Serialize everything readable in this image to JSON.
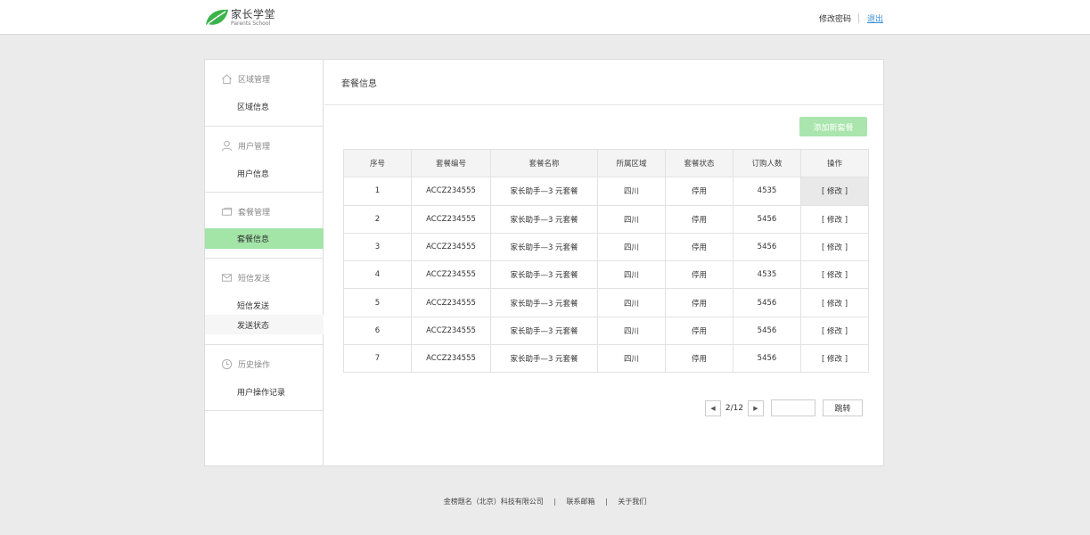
{
  "header": {
    "logo_cn": "家长学堂",
    "logo_en": "Parents School",
    "change_password": "修改密码",
    "logout": "退出"
  },
  "sidebar": {
    "groups": [
      {
        "title": "区域管理",
        "icon": "home-icon",
        "items": [
          "区域信息"
        ]
      },
      {
        "title": "用户管理",
        "icon": "user-icon",
        "items": [
          "用户信息"
        ]
      },
      {
        "title": "套餐管理",
        "icon": "card-icon",
        "items": [
          "套餐信息"
        ]
      },
      {
        "title": "短信发送",
        "icon": "mail-icon",
        "items": [
          "短信发送",
          "发送状态"
        ]
      },
      {
        "title": "历史操作",
        "icon": "clock-icon",
        "items": [
          "用户操作记录"
        ]
      }
    ],
    "active_item": "套餐信息"
  },
  "content": {
    "title": "套餐信息",
    "add_button": "添加新套餐",
    "columns": [
      "序号",
      "套餐编号",
      "套餐名称",
      "所属区域",
      "套餐状态",
      "订购人数",
      "操作"
    ],
    "rows": [
      [
        "1",
        "ACCZ234555",
        "家长助手—3 元套餐",
        "四川",
        "停用",
        "4535",
        "[ 修改 ]"
      ],
      [
        "2",
        "ACCZ234555",
        "家长助手—3 元套餐",
        "四川",
        "停用",
        "5456",
        "[ 修改 ]"
      ],
      [
        "3",
        "ACCZ234555",
        "家长助手—3 元套餐",
        "四川",
        "停用",
        "5456",
        "[ 修改 ]"
      ],
      [
        "4",
        "ACCZ234555",
        "家长助手—3 元套餐",
        "四川",
        "停用",
        "4535",
        "[ 修改 ]"
      ],
      [
        "5",
        "ACCZ234555",
        "家长助手—3 元套餐",
        "四川",
        "停用",
        "5456",
        "[ 修改 ]"
      ],
      [
        "6",
        "ACCZ234555",
        "家长助手—3 元套餐",
        "四川",
        "停用",
        "5456",
        "[ 修改 ]"
      ],
      [
        "7",
        "ACCZ234555",
        "家长助手—3 元套餐",
        "四川",
        "停用",
        "5456",
        "[ 修改 ]"
      ]
    ],
    "pager": {
      "prev_icon": "caret-left-icon",
      "page_text": "2/12",
      "next_icon": "caret-right-icon",
      "input_value": "",
      "jump_label": "跳转"
    }
  },
  "footer": {
    "company": "金榜题名（北京）科技有限公司",
    "separator": "|",
    "email": "联系邮箱",
    "about": "关于我们"
  },
  "colors": {
    "accent_green": "#a3e4a7",
    "button_green": "#a9e5ad",
    "logo_green": "#3cb44b",
    "link_blue": "#3b8fd9",
    "page_bg": "#ebebeb"
  }
}
